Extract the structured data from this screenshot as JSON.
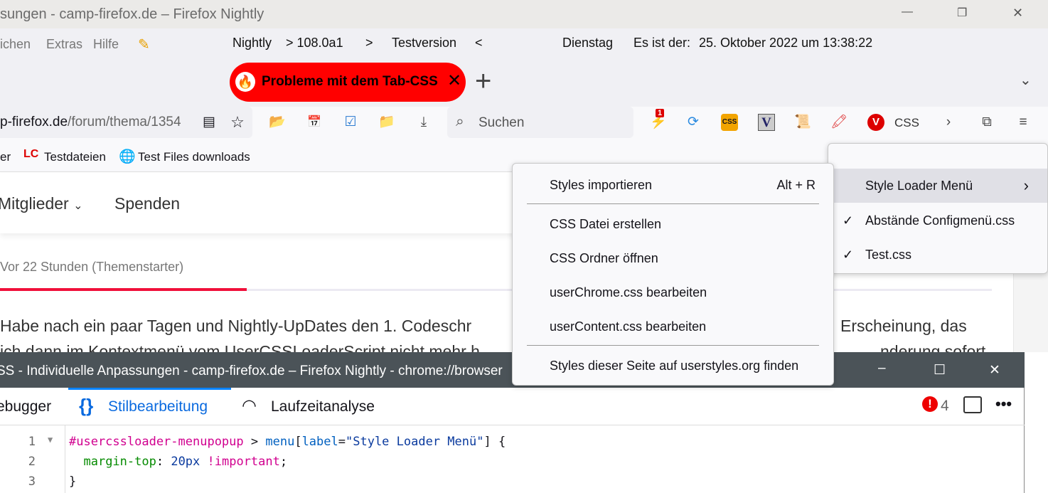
{
  "window": {
    "title": "sungen - camp-firefox.de – Firefox Nightly"
  },
  "menubar": {
    "items": [
      "ichen",
      "Extras",
      "Hilfe"
    ],
    "status": {
      "product": "Nightly",
      "version": "> 108.0a1",
      "sep": ">",
      "testversion": "Testversion",
      "lt": "<",
      "weekday": "Dienstag",
      "date_label": "Es ist der:",
      "date": "25. Oktober 2022 um 13:38:22"
    }
  },
  "tab": {
    "title": "Probleme mit dem Tab-CSS"
  },
  "navbar": {
    "url_host": "p-firefox.de",
    "url_path": "/forum/thema/1354",
    "search_placeholder": "Suchen",
    "badge": "1",
    "css_label": "CSS"
  },
  "bookmarks": [
    {
      "label": "er"
    },
    {
      "label": "Testdateien"
    },
    {
      "label": "Test Files downloads"
    }
  ],
  "page": {
    "nav": [
      "Mitglieder",
      "Spenden"
    ],
    "meta": "Vor 22 Stunden (Themenstarter)",
    "line1a": "Habe nach ein paar Tagen und Nightly-UpDates den 1. Codeschr",
    "line1b": "Erscheinung, das",
    "line2a": "ich dann im Kontextmenü vom UserCSSLoaderScript nicht mehr h",
    "line2b": "nderung sofort"
  },
  "devtools": {
    "title": "SS - Individuelle Anpassungen - camp-firefox.de – Firefox Nightly - chrome://browser",
    "tabs": [
      "ebugger",
      "Stilbearbeitung",
      "Laufzeitanalyse"
    ],
    "error_count": "4",
    "code": [
      {
        "n": "1",
        "sel": "#usercssloader-menupopup",
        "op": " > ",
        "el": "menu",
        "b1": "[",
        "attr": "label",
        "eq": "=",
        "str": "\"Style Loader Menü\"",
        "b2": "]",
        "rest": " {"
      },
      {
        "n": "2",
        "prop": "margin-top",
        "colon": ": ",
        "val": "20px",
        "imp": " !important",
        "semi": ";"
      },
      {
        "n": "3",
        "close": "}"
      }
    ]
  },
  "context_menu": {
    "items": [
      {
        "label": "Styles importieren",
        "shortcut": "Alt + R"
      },
      {
        "label": "CSS Datei erstellen"
      },
      {
        "label": "CSS Ordner öffnen"
      },
      {
        "label": "userChrome.css bearbeiten"
      },
      {
        "label": "userContent.css bearbeiten"
      },
      {
        "label": "Styles dieser Seite auf userstyles.org finden"
      }
    ]
  },
  "submenu": {
    "title": "Style Loader Menü",
    "items": [
      {
        "label": "Abstände Configmenü.css",
        "checked": true
      },
      {
        "label": "Test.css",
        "checked": true
      }
    ]
  }
}
